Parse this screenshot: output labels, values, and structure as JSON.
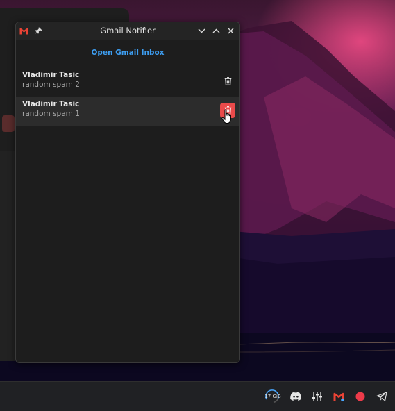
{
  "window": {
    "title": "Gmail Notifier"
  },
  "header": {
    "open_inbox_label": "Open Gmail Inbox"
  },
  "emails": [
    {
      "sender": "Vladimir Tasic",
      "subject": "random spam 2",
      "hovered": false
    },
    {
      "sender": "Vladimir Tasic",
      "subject": "random spam 1",
      "hovered": true
    }
  ],
  "taskbar": {
    "memory_label": "17 GiB",
    "tray_icons": [
      "memory-indicator-icon",
      "discord-icon",
      "audio-mixer-icon",
      "gmail-icon",
      "record-icon",
      "telegram-icon"
    ]
  },
  "colors": {
    "accent": "#3d9df0",
    "delete_active": "#ea4a4a",
    "gmail_red": "#ea4335"
  }
}
